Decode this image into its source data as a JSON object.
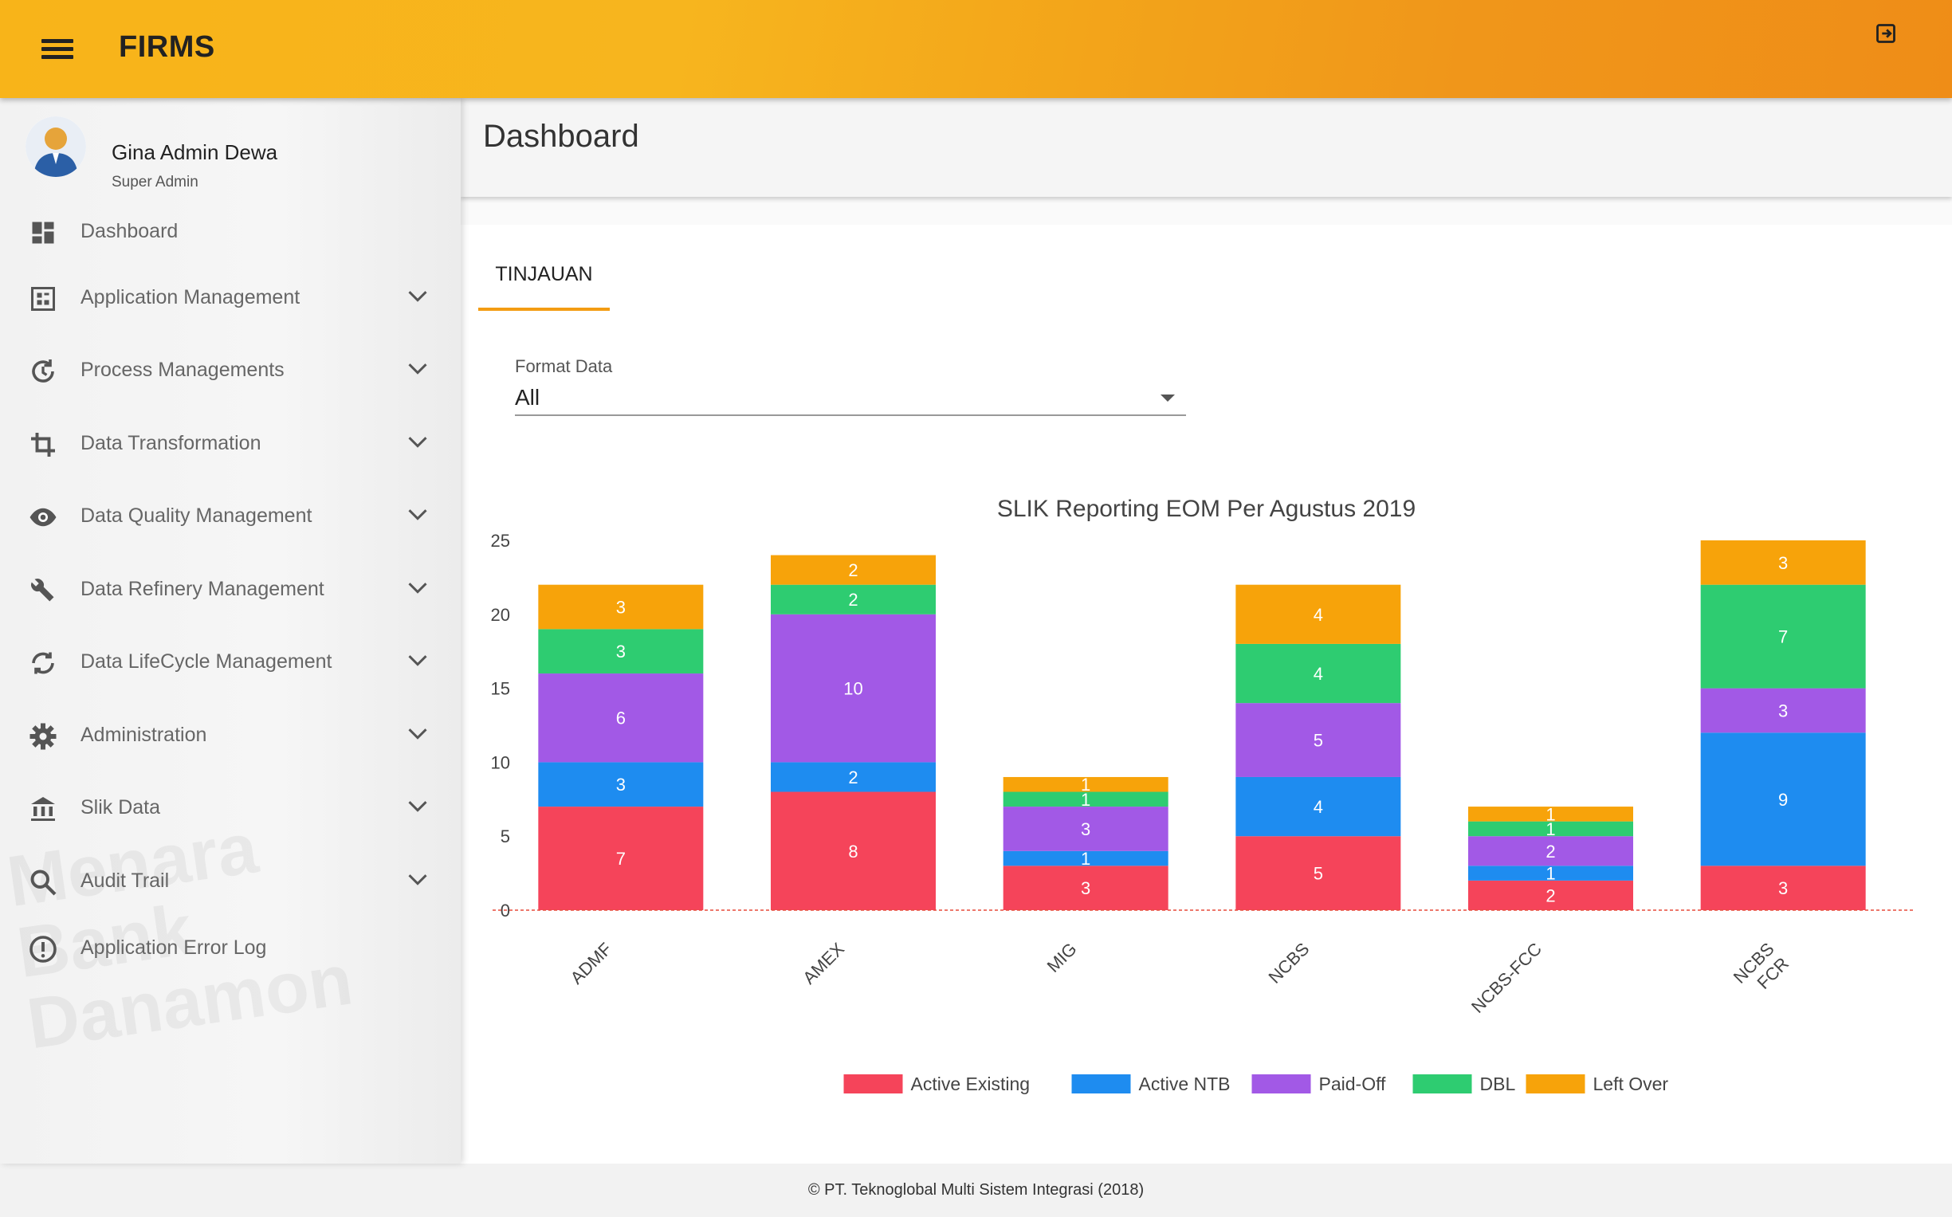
{
  "app": {
    "title": "FIRMS"
  },
  "user": {
    "name": "Gina Admin Dewa",
    "role": "Super Admin"
  },
  "sidebar": {
    "items": [
      {
        "label": "Dashboard",
        "icon": "dashboard-icon",
        "expandable": false
      },
      {
        "label": "Application Management",
        "icon": "app-grid-icon",
        "expandable": true
      },
      {
        "label": "Process Managements",
        "icon": "refresh-clock-icon",
        "expandable": true
      },
      {
        "label": "Data Transformation",
        "icon": "crop-icon",
        "expandable": true
      },
      {
        "label": "Data Quality Management",
        "icon": "eye-icon",
        "expandable": true
      },
      {
        "label": "Data Refinery Management",
        "icon": "wrench-icon",
        "expandable": true
      },
      {
        "label": "Data LifeCycle Management",
        "icon": "cycle-icon",
        "expandable": true
      },
      {
        "label": "Administration",
        "icon": "gear-icon",
        "expandable": true
      },
      {
        "label": "Slik Data",
        "icon": "bank-icon",
        "expandable": true
      },
      {
        "label": "Audit Trail",
        "icon": "search-icon",
        "expandable": true
      },
      {
        "label": "Application Error Log",
        "icon": "alert-circle-icon",
        "expandable": false
      }
    ]
  },
  "page": {
    "title": "Dashboard"
  },
  "tabs": [
    {
      "label": "TINJAUAN",
      "active": true
    }
  ],
  "filter": {
    "label": "Format Data",
    "value": "All"
  },
  "footer": {
    "text": "© PT. Teknoglobal Multi Sistem Integrasi (2018)"
  },
  "colors": {
    "accent": "#f39c12",
    "active_existing": "#f5445a",
    "active_ntb": "#1e8cf0",
    "paid_off": "#a259e6",
    "dbl": "#2ecc71",
    "left_over": "#f7a30a"
  },
  "chart_data": {
    "type": "bar",
    "stacked": true,
    "title": "SLIK Reporting EOM Per Agustus 2019",
    "categories": [
      "ADMF",
      "AMEX",
      "MIG",
      "NCBS",
      "NCBS-FCC",
      "NCBS FCR"
    ],
    "series": [
      {
        "name": "Active Existing",
        "color": "#f5445a",
        "values": [
          7,
          8,
          3,
          5,
          2,
          3
        ]
      },
      {
        "name": "Active NTB",
        "color": "#1e8cf0",
        "values": [
          3,
          2,
          1,
          4,
          1,
          9
        ]
      },
      {
        "name": "Paid-Off",
        "color": "#a259e6",
        "values": [
          6,
          10,
          3,
          5,
          2,
          3
        ]
      },
      {
        "name": "DBL",
        "color": "#2ecc71",
        "values": [
          3,
          2,
          1,
          4,
          1,
          7
        ]
      },
      {
        "name": "Left Over",
        "color": "#f7a30a",
        "values": [
          3,
          2,
          1,
          4,
          1,
          3
        ]
      }
    ],
    "ylim": [
      0,
      25
    ],
    "yticks": [
      0,
      5,
      10,
      15,
      20,
      25
    ],
    "legend": "bottom",
    "grid": false
  }
}
